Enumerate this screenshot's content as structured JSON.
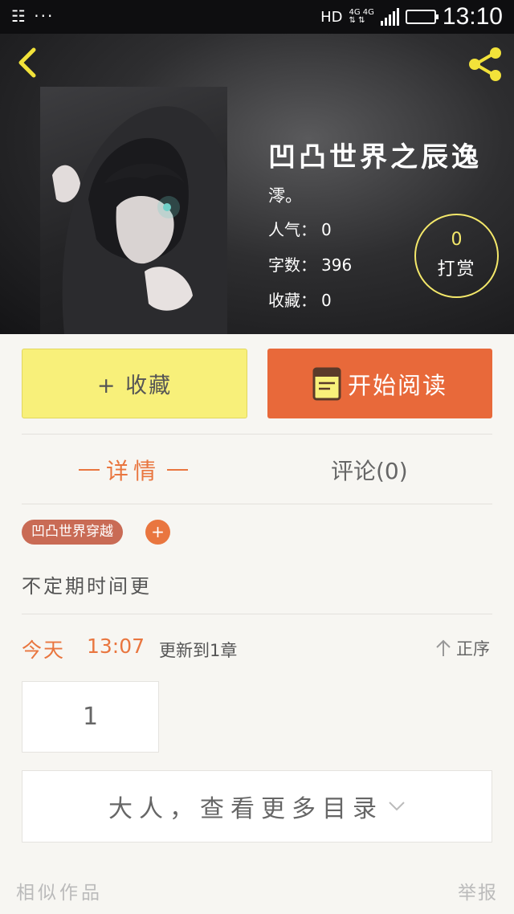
{
  "status_bar": {
    "left_icons": "☷ ···",
    "hd": "HD",
    "net_top": "4G 4G",
    "net_bottom": "⇅ ⇅",
    "time": "13:10"
  },
  "header": {
    "back_icon": "chevron-left-icon",
    "share_icon": "share-icon",
    "title": "凹凸世界之辰逸",
    "author": "澪。",
    "stats": [
      {
        "label": "人气：",
        "value": "0"
      },
      {
        "label": "字数：",
        "value": "396"
      },
      {
        "label": "收藏：",
        "value": "0"
      }
    ],
    "reward": {
      "count": "0",
      "label": "打赏"
    }
  },
  "actions": {
    "favorite_label": "+ 收藏",
    "read_label": "开始阅读"
  },
  "tabs": {
    "detail": "详情",
    "comments": "评论(0)"
  },
  "tags": [
    "凹凸世界穿越"
  ],
  "tag_add": "+",
  "description": "不定期时间更",
  "update": {
    "day": "今天",
    "time": "13:07",
    "text": "更新到1章",
    "sort_label": "正序"
  },
  "chapters": [
    "1"
  ],
  "more_label": "大人，查看更多目录",
  "footer": {
    "similar": "相似作品",
    "report": "举报"
  },
  "colors": {
    "accent_orange": "#e8693a",
    "favorite_yellow": "#f8f07a",
    "reward_ring": "#f4e86a",
    "tag_bg": "#c96b55"
  }
}
